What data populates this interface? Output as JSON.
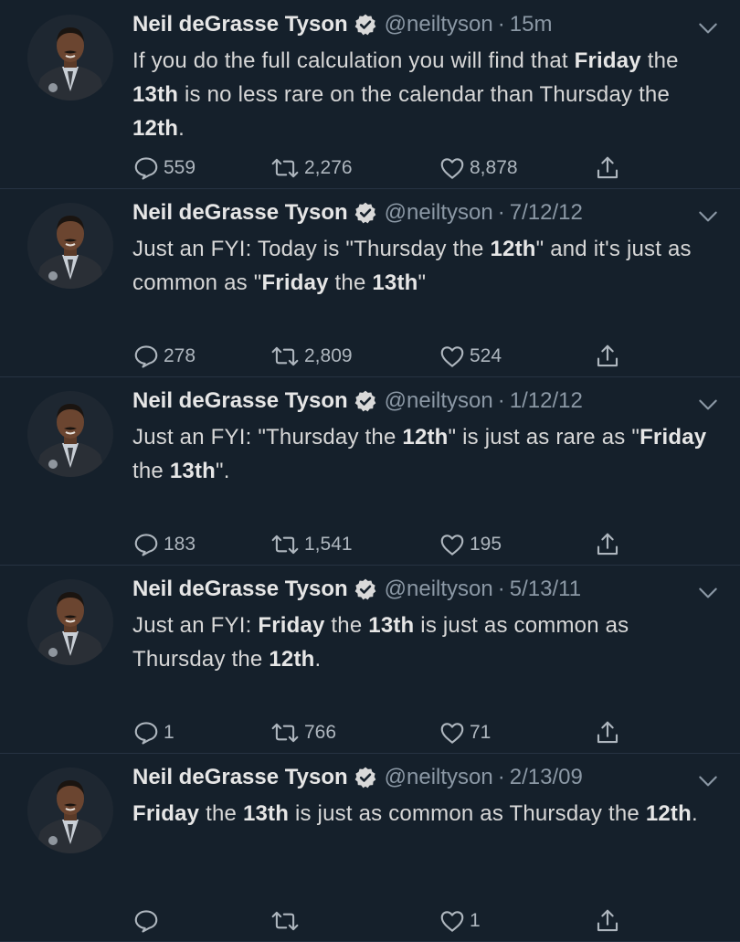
{
  "colors": {
    "background": "#15202b",
    "verified_badge": "#d9d9d9",
    "muted_text": "#8b98a5"
  },
  "icons": {
    "reply": "speech-bubble-icon",
    "retweet": "retweet-arrows-icon",
    "like": "heart-outline-icon",
    "share": "upload-arrow-icon",
    "verified": "verified-badge-icon",
    "menu": "chevron-down-icon"
  },
  "tweets": [
    {
      "name": "Neil deGrasse Tyson",
      "handle": "@neiltyson",
      "separator": "·",
      "time": "15m",
      "text_parts": [
        {
          "text": "If you do the full calculation you will find that ",
          "bold": false
        },
        {
          "text": "Friday",
          "bold": true
        },
        {
          "text": " the ",
          "bold": false
        },
        {
          "text": "13th",
          "bold": true
        },
        {
          "text": " is no less rare on the calendar than Thursday the ",
          "bold": false
        },
        {
          "text": "12th",
          "bold": true
        },
        {
          "text": ".",
          "bold": false
        }
      ],
      "replies": "559",
      "retweets": "2,276",
      "likes": "8,878"
    },
    {
      "name": "Neil deGrasse Tyson",
      "handle": "@neiltyson",
      "separator": "·",
      "time": "7/12/12",
      "text_parts": [
        {
          "text": "Just an FYI:  Today is \"Thursday the ",
          "bold": false
        },
        {
          "text": "12th",
          "bold": true
        },
        {
          "text": "\" and it's just as common as \"",
          "bold": false
        },
        {
          "text": "Friday",
          "bold": true
        },
        {
          "text": " the ",
          "bold": false
        },
        {
          "text": "13th",
          "bold": true
        },
        {
          "text": "\"",
          "bold": false
        }
      ],
      "replies": "278",
      "retweets": "2,809",
      "likes": "524"
    },
    {
      "name": "Neil deGrasse Tyson",
      "handle": "@neiltyson",
      "separator": "·",
      "time": "1/12/12",
      "text_parts": [
        {
          "text": "Just an FYI: \"Thursday the ",
          "bold": false
        },
        {
          "text": "12th",
          "bold": true
        },
        {
          "text": "\" is just as rare as \"",
          "bold": false
        },
        {
          "text": "Friday",
          "bold": true
        },
        {
          "text": " the ",
          "bold": false
        },
        {
          "text": "13th",
          "bold": true
        },
        {
          "text": "\".",
          "bold": false
        }
      ],
      "replies": "183",
      "retweets": "1,541",
      "likes": "195"
    },
    {
      "name": "Neil deGrasse Tyson",
      "handle": "@neiltyson",
      "separator": "·",
      "time": "5/13/11",
      "text_parts": [
        {
          "text": "Just an FYI: ",
          "bold": false
        },
        {
          "text": "Friday",
          "bold": true
        },
        {
          "text": " the ",
          "bold": false
        },
        {
          "text": "13th",
          "bold": true
        },
        {
          "text": " is just as common as Thursday the ",
          "bold": false
        },
        {
          "text": "12th",
          "bold": true
        },
        {
          "text": ".",
          "bold": false
        }
      ],
      "replies": "1",
      "retweets": "766",
      "likes": "71"
    },
    {
      "name": "Neil deGrasse Tyson",
      "handle": "@neiltyson",
      "separator": "·",
      "time": "2/13/09",
      "text_parts": [
        {
          "text": "Friday",
          "bold": true
        },
        {
          "text": " the ",
          "bold": false
        },
        {
          "text": "13th",
          "bold": true
        },
        {
          "text": " is just as common as Thursday the ",
          "bold": false
        },
        {
          "text": "12th",
          "bold": true
        },
        {
          "text": ".",
          "bold": false
        }
      ],
      "replies": "",
      "retweets": "",
      "likes": "1"
    }
  ]
}
